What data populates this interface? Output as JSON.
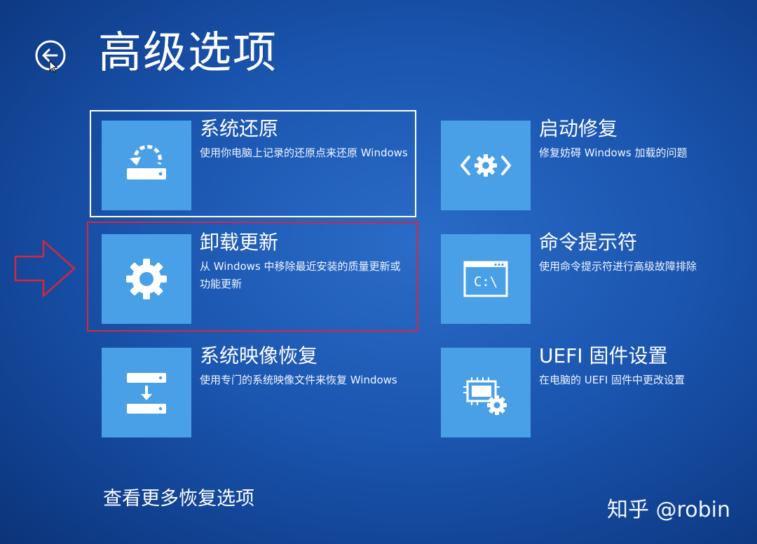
{
  "header": {
    "title": "高级选项",
    "back_icon": "back-arrow-icon"
  },
  "options": [
    {
      "title": "系统还原",
      "desc": "使用你电脑上记录的还原点来还原 Windows",
      "icon": "system-restore-icon",
      "selected": true
    },
    {
      "title": "启动修复",
      "desc": "修复妨碍 Windows 加载的问题",
      "icon": "startup-repair-icon"
    },
    {
      "title": "卸载更新",
      "desc": "从 Windows 中移除最近安装的质量更新或功能更新",
      "icon": "gear-icon",
      "highlighted": true
    },
    {
      "title": "命令提示符",
      "desc": "使用命令提示符进行高级故障排除",
      "icon": "command-prompt-icon",
      "prompt_text": "C:\\"
    },
    {
      "title": "系统映像恢复",
      "desc": "使用专门的系统映像文件来恢复 Windows",
      "icon": "system-image-recovery-icon"
    },
    {
      "title": "UEFI 固件设置",
      "desc": "在电脑的 UEFI 固件中更改设置",
      "icon": "uefi-firmware-icon"
    }
  ],
  "footer": {
    "more_options": "查看更多恢复选项"
  },
  "watermark": "知乎 @robin",
  "colors": {
    "background": "#1b56b0",
    "tile": "#4aa0e6",
    "selection_border": "#ffffff",
    "annotation_red": "#d9263a"
  }
}
